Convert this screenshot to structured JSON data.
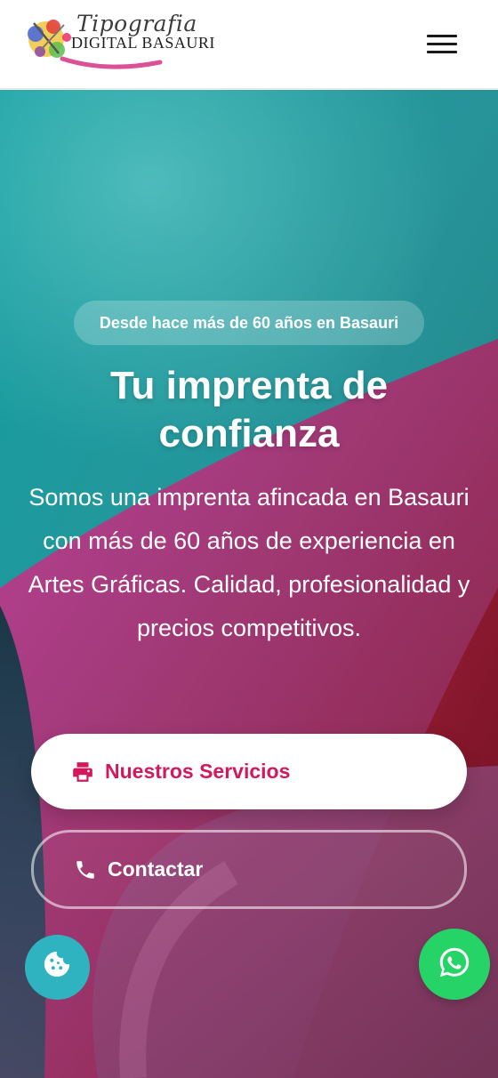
{
  "header": {
    "logo": {
      "line1": "Tipografia",
      "line2": "DIGITAL BASAURI"
    },
    "menu_icon": "hamburger-menu-icon"
  },
  "hero": {
    "eyebrow": "Desde hace más de 60 años en Basauri",
    "title": "Tu imprenta de confianza",
    "description": "Somos una imprenta afincada en Basauri con más de 60 años de experiencia en Artes Gráficas. Calidad, profesionalidad y precios competitivos.",
    "buttons": {
      "services": {
        "label": "Nuestros Servicios",
        "icon": "printer-icon"
      },
      "contact": {
        "label": "Contactar",
        "icon": "phone-icon"
      }
    }
  },
  "floating": {
    "cookie_icon": "cookie-icon",
    "whatsapp_icon": "whatsapp-icon"
  },
  "colors": {
    "accent": "#d3195e",
    "teal": "#1e8e93",
    "magenta": "#b5347e",
    "whatsapp": "#25d366",
    "cookie": "#2fb3c0"
  }
}
